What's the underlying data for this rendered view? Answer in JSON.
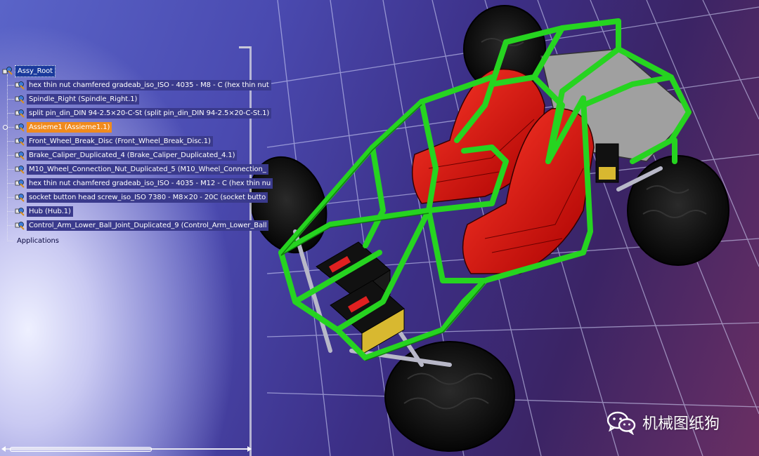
{
  "tree": {
    "root": "Assy_Root",
    "items": [
      {
        "label": "hex thin nut chamfered gradeab_iso_ISO - 4035 - M8 - C (hex thin nut",
        "selected": false
      },
      {
        "label": "Spindle_Right (Spindle_Right.1)",
        "selected": false
      },
      {
        "label": "split pin_din_DIN 94-2.5×20-C-St (split pin_din_DIN 94-2.5×20-C-St.1)",
        "selected": false
      },
      {
        "label": "Assieme1 (Assieme1.1)",
        "selected": true
      },
      {
        "label": "Front_Wheel_Break_Disc (Front_Wheel_Break_Disc.1)",
        "selected": false
      },
      {
        "label": "Brake_Caliper_Duplicated_4 (Brake_Caliper_Duplicated_4.1)",
        "selected": false
      },
      {
        "label": "M10_Wheel_Connection_Nut_Duplicated_5 (M10_Wheel_Connection_",
        "selected": false
      },
      {
        "label": "hex thin nut chamfered gradeab_iso_ISO - 4035 - M12 - C (hex thin nu",
        "selected": false
      },
      {
        "label": "socket button head screw_iso_ISO 7380 - M8×20 - 20C (socket butto",
        "selected": false
      },
      {
        "label": "Hub (Hub.1)",
        "selected": false
      },
      {
        "label": "Control_Arm_Lower_Ball_Joint_Duplicated_9 (Control_Arm_Lower_Ball",
        "selected": false
      }
    ],
    "applications": "Applications"
  },
  "watermark": {
    "text": "机械图纸狗",
    "icon": "wechat-icon"
  },
  "colors": {
    "frame": "#22d01e",
    "seat": "#e01010",
    "tire": "#0c0c0c",
    "selection": "#f08a1c",
    "tree_label_bg": "#3a3a8c"
  }
}
